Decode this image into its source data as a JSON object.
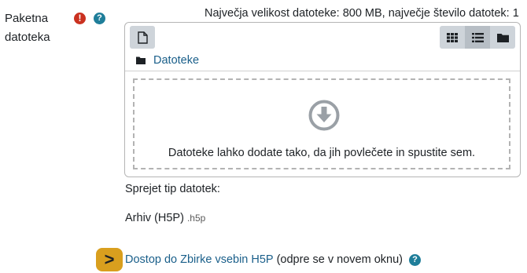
{
  "field": {
    "label_line1": "Paketna",
    "label_line2": "datoteka",
    "required_icon": "exclamation-circle-icon",
    "help_icon": "question-circle-icon"
  },
  "limits_text": "Največja velikost datoteke: 800 MB, največje število datotek: 1",
  "filemanager": {
    "add_icon": "file-icon",
    "view_icons": [
      "grid-icon",
      "list-icon",
      "folder-icon"
    ],
    "active_view": "list-icon",
    "path_label": "Datoteke",
    "drop_text": "Datoteke lahko dodate tako, da jih povlečete in spustite sem."
  },
  "accepted": {
    "label": "Sprejet tip datotek:",
    "item_name": "Arhiv (H5P)",
    "item_ext": ".h5p"
  },
  "access": {
    "badge_symbol": ">",
    "link_text": "Dostop do Zbirke vsebin H5P",
    "note": "(odpre se v novem oknu)"
  },
  "colors": {
    "link": "#1a5f8a",
    "required": "#ca3120",
    "help": "#1f7e9a",
    "badge": "#d99f1e"
  }
}
